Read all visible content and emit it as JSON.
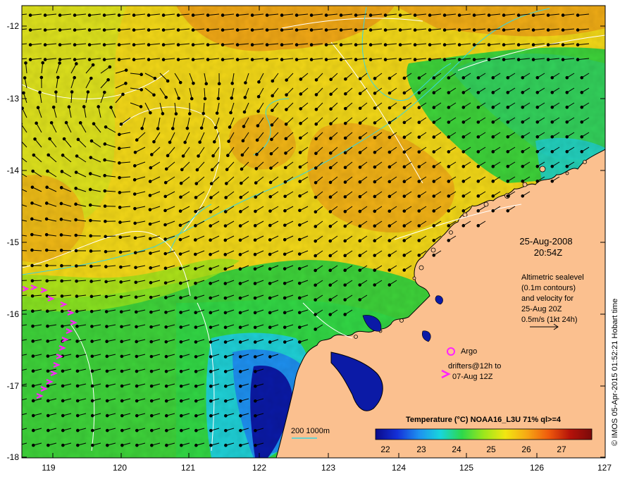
{
  "map": {
    "lon_ticks": [
      "119",
      "120",
      "121",
      "122",
      "123",
      "124",
      "125",
      "126",
      "127"
    ],
    "lat_ticks": [
      "-12",
      "-13",
      "-14",
      "-15",
      "-16",
      "-17",
      "-18"
    ],
    "colors": {
      "land": "#fbc08f",
      "deep_blue": "#0b1aa6",
      "cyan": "#1fd0d6",
      "green": "#3ed23a",
      "yellow_green": "#c8e81a",
      "yellow": "#f3d818",
      "orange": "#f0a716",
      "contour_cyan": "#38d6e0",
      "contour_white": "#ffffff",
      "argo_magenta": "#ff22ff"
    }
  },
  "annotations": {
    "date": "25-Aug-2008",
    "time": "20:54Z",
    "altimetry_lines": [
      "Altimetric sealevel",
      "(0.1m contours)",
      "and velocity for",
      "25-Aug 20Z",
      "0.5m/s (1kt 24h)"
    ],
    "argo_label": "Argo",
    "drifters_lines": [
      "drifters@12h to",
      "07-Aug 12Z"
    ],
    "depth_label": "200  1000m"
  },
  "colorbar": {
    "title": "Temperature (°C) NOAA16_L3U 71% ql>=4",
    "ticks": [
      "22",
      "23",
      "24",
      "25",
      "26",
      "27"
    ],
    "stops": [
      "#0a0a8a",
      "#1430d8",
      "#1e90f0",
      "#18d6dc",
      "#2ed84a",
      "#9be61c",
      "#f2e612",
      "#f6a814",
      "#f05a0c",
      "#b4120a",
      "#7a0a0a"
    ]
  },
  "credit": "© IMOS 05-Apr-2015 01:52:21 Hobart time"
}
